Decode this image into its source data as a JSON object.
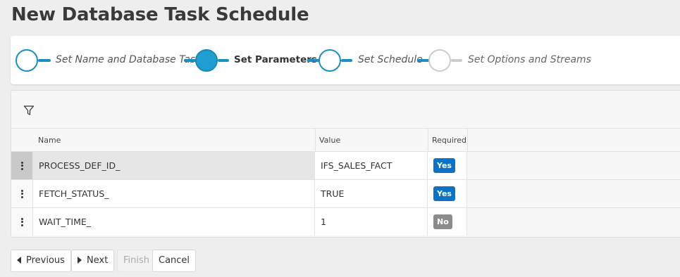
{
  "page": {
    "title": "New Database Task Schedule"
  },
  "wizard": {
    "steps": [
      {
        "label": "Set Name and Database Task",
        "state": "completed"
      },
      {
        "label": "Set Parameters",
        "state": "active"
      },
      {
        "label": "Set Schedule",
        "state": "completed"
      },
      {
        "label": "Set Options and Streams",
        "state": "future"
      }
    ],
    "colors": {
      "accent": "#1a8fc1",
      "active_fill": "#1e9fd0",
      "future": "#cccccc"
    }
  },
  "grid": {
    "filter_icon": "filter-icon",
    "columns": {
      "name": "Name",
      "value": "Value",
      "required": "Required"
    },
    "rows": [
      {
        "name": "PROCESS_DEF_ID_",
        "value": "IFS_SALES_FACT",
        "required": "Yes",
        "selected": true
      },
      {
        "name": "FETCH_STATUS_",
        "value": "TRUE",
        "required": "Yes",
        "selected": false
      },
      {
        "name": "WAIT_TIME_",
        "value": "1",
        "required": "No",
        "selected": false
      }
    ],
    "colors": {
      "yes_badge": "#0b72c6",
      "no_badge": "#8c8c8c"
    }
  },
  "footer": {
    "previous_label": "Previous",
    "next_label": "Next",
    "finish_label": "Finish",
    "cancel_label": "Cancel"
  }
}
